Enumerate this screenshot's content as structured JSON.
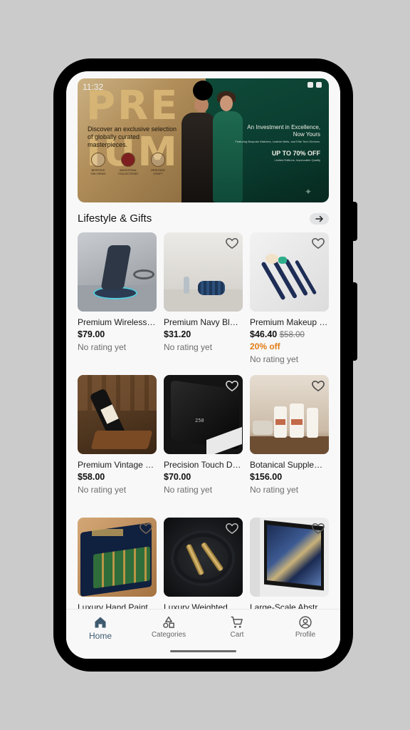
{
  "status_bar": {
    "time": "11:32"
  },
  "banner": {
    "word_left": "PRE",
    "word_right": "IUM",
    "tagline_left": "Discover an exclusive selection of globally curated masterpieces.",
    "icons": [
      {
        "name": "bespoke-tailoring-icon",
        "label": "BESPOKE TAILORING"
      },
      {
        "name": "ancestral-collections-icon",
        "label": "ANCESTRAL COLLECTIONS"
      },
      {
        "name": "heritage-craft-icon",
        "label": "HERITAGE CRAFT"
      }
    ],
    "right_line1": "An Investment in Excellence, Now Yours",
    "right_line2": "Featuring Bespoke Watches, Leather Belts, and Elite Tech Devices.",
    "right_offer": "UP TO 70% OFF",
    "right_line3": "Limited Editions, Impeccable Quality"
  },
  "section": {
    "title": "Lifestyle & Gifts"
  },
  "products": [
    {
      "name": "Premium Wireless Charging Stand",
      "price": "$79.00",
      "old_price": "",
      "discount": "",
      "rating": "No rating yet",
      "image": "wireless-charger"
    },
    {
      "name": "Premium Navy Blue Foam Roller",
      "price": "$31.20",
      "old_price": "",
      "discount": "",
      "rating": "No rating yet",
      "image": "foam-roller"
    },
    {
      "name": "Premium Makeup Brush Set",
      "price": "$46.40",
      "old_price": "$58.00",
      "discount": "20% off",
      "rating": "No rating yet",
      "image": "makeup-brushes"
    },
    {
      "name": "Premium Vintage Wine Holder",
      "price": "$58.00",
      "old_price": "",
      "discount": "",
      "rating": "No rating yet",
      "image": "wine-bottle"
    },
    {
      "name": "Precision Touch Digital Scale",
      "price": "$70.00",
      "old_price": "",
      "discount": "",
      "rating": "No rating yet",
      "image": "digital-scale"
    },
    {
      "name": "Botanical Supplement Set",
      "price": "$156.00",
      "old_price": "",
      "discount": "",
      "rating": "No rating yet",
      "image": "supplement-bottles"
    },
    {
      "name": "Luxury Hand Painted Chocolates",
      "price": "",
      "old_price": "",
      "discount": "",
      "rating": "",
      "image": "chocolate-box"
    },
    {
      "name": "Luxury Weighted Jump Rope",
      "price": "",
      "old_price": "",
      "discount": "",
      "rating": "",
      "image": "jump-rope"
    },
    {
      "name": "Large-Scale Abstract Canvas",
      "price": "",
      "old_price": "",
      "discount": "",
      "rating": "",
      "image": "abstract-art"
    }
  ],
  "nav": [
    {
      "label": "Home",
      "icon": "home-icon",
      "active": true
    },
    {
      "label": "Categories",
      "icon": "categories-icon",
      "active": false
    },
    {
      "label": "Cart",
      "icon": "cart-icon",
      "active": false
    },
    {
      "label": "Profile",
      "icon": "profile-icon",
      "active": false
    }
  ],
  "colors": {
    "accent": "#3e5a6e",
    "discount": "#e07b12",
    "banner_green": "#0a3b2e",
    "banner_gold": "#d8b676"
  }
}
